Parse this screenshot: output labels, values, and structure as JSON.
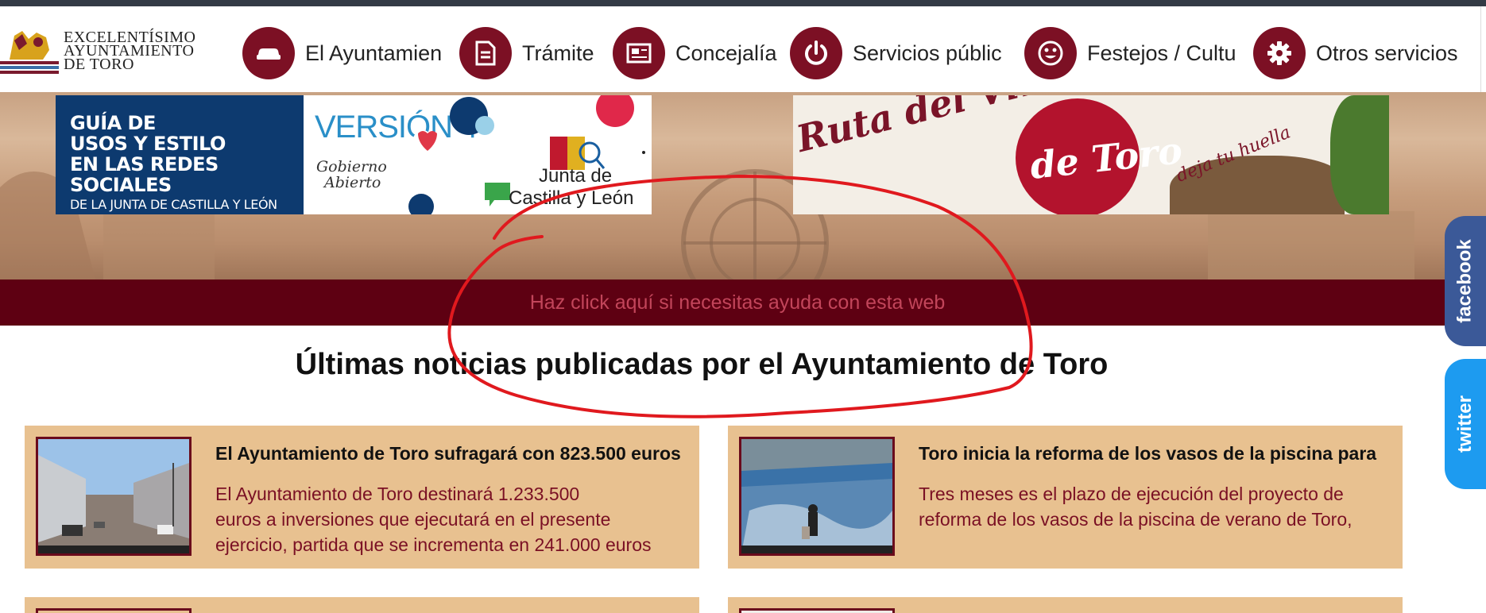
{
  "header": {
    "logo_lines": [
      "EXCELENTÍSIMO",
      "AYUNTAMIENTO",
      "DE TORO"
    ],
    "nav": [
      {
        "label": "El Ayuntamien",
        "icon": "car-icon"
      },
      {
        "label": "Trámite",
        "icon": "document-icon"
      },
      {
        "label": "Concejalía",
        "icon": "newspaper-icon"
      },
      {
        "label": "Servicios públic",
        "icon": "power-icon"
      },
      {
        "label": "Festejos / Cultu",
        "icon": "smile-icon"
      },
      {
        "label": "Otros servicios",
        "icon": "gear-icon"
      }
    ]
  },
  "banners": {
    "left": {
      "title_lines": [
        "GUÍA DE",
        "USOS Y ESTILO",
        "EN LAS REDES SOCIALES"
      ],
      "subtitle": "DE LA JUNTA DE CASTILLA Y LEÓN",
      "version": "VERSIÓN 4",
      "gobierno_lines": [
        "Gobierno",
        "Abierto"
      ],
      "junta_lines": [
        "Junta de",
        "Castilla y León"
      ]
    },
    "right": {
      "ruta": "Ruta del Vino",
      "detoro": "de Toro",
      "huella": "deja tu huella"
    }
  },
  "helpbar": {
    "text": "Haz click aquí si necesitas ayuda con esta web"
  },
  "social": {
    "facebook": "facebook",
    "twitter": "twitter"
  },
  "news": {
    "title": "Últimas noticias publicadas por el Ayuntamiento de Toro",
    "items": [
      {
        "title": "El Ayuntamiento de Toro sufragará con 823.500 euros",
        "body_lines": [
          "El Ayuntamiento de Toro destinará 1.233.500",
          "euros a inversiones que ejecutará en el presente",
          "ejercicio, partida que se incrementa en 241.000 euros"
        ]
      },
      {
        "title": "Toro inicia la reforma de los vasos de la piscina para",
        "body_lines": [
          "Tres meses es el plazo de ejecución del proyecto de",
          "reforma de los vasos de la piscina de verano de Toro,"
        ]
      }
    ]
  },
  "colors": {
    "brand": "#7c1024",
    "helpbar": "#5e0012",
    "card": "#e8c190",
    "annotation": "#e0191e"
  }
}
